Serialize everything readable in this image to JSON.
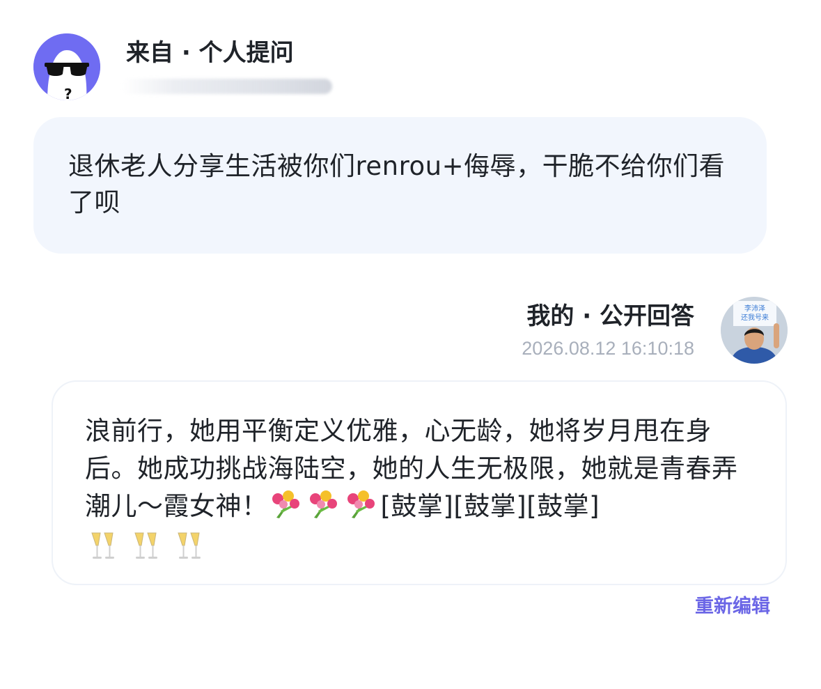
{
  "question": {
    "header_title": "来自 · 个人提问",
    "text": "退休老人分享生活被你们renrou+侮辱，干脆不给你们看了呗",
    "bubble_color": "#f2f6fd"
  },
  "asker": {
    "avatar_icon": "sunglasses-ghost-avatar",
    "avatar_bg": "#6f6cf2"
  },
  "answer": {
    "header_title": "我的 · 公开回答",
    "timestamp": "2026.08.12 16:10:18",
    "text_part1": "浪前行，她用平衡定义优雅，心无龄，她将岁月甩在身后。她成功挑战海陆空，她的人生无极限，她就是青春弄潮儿～霞女神！",
    "flower_emoji_count": 3,
    "text_part2": "[鼓掌][鼓掌][鼓掌]",
    "cheers_emoji_count": 3
  },
  "answerer": {
    "avatar_sign_text_line1": "李沛泽",
    "avatar_sign_text_line2": "还我号来"
  },
  "actions": {
    "re_edit_label": "重新编辑",
    "accent_color": "#6b66e6"
  }
}
